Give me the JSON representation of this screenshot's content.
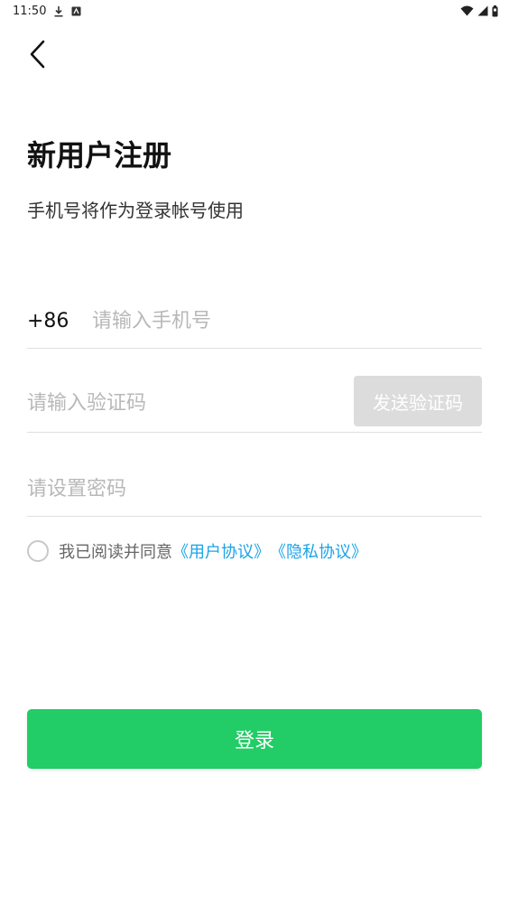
{
  "status_bar": {
    "time": "11:50",
    "icons": [
      "download-icon",
      "notification-icon",
      "wifi-icon",
      "signal-icon",
      "battery-icon"
    ]
  },
  "header": {
    "back_icon": "chevron-left-icon",
    "title": "新用户注册",
    "subtitle": "手机号将作为登录帐号使用"
  },
  "form": {
    "phone": {
      "country_code": "+86",
      "value": "",
      "placeholder": "请输入手机号"
    },
    "verification": {
      "value": "",
      "placeholder": "请输入验证码",
      "send_button_label": "发送验证码"
    },
    "password": {
      "value": "",
      "placeholder": "请设置密码"
    }
  },
  "agreement": {
    "checked": false,
    "text": "我已阅读并同意",
    "user_agreement": "《用户协议》",
    "privacy_agreement": "《隐私协议》"
  },
  "login_button_label": "登录",
  "colors": {
    "primary": "#22cc66",
    "link": "#1aa3e8",
    "disabled_button": "#dcdcdc",
    "placeholder": "#b8b8b8",
    "divider": "#e0e0e0"
  }
}
